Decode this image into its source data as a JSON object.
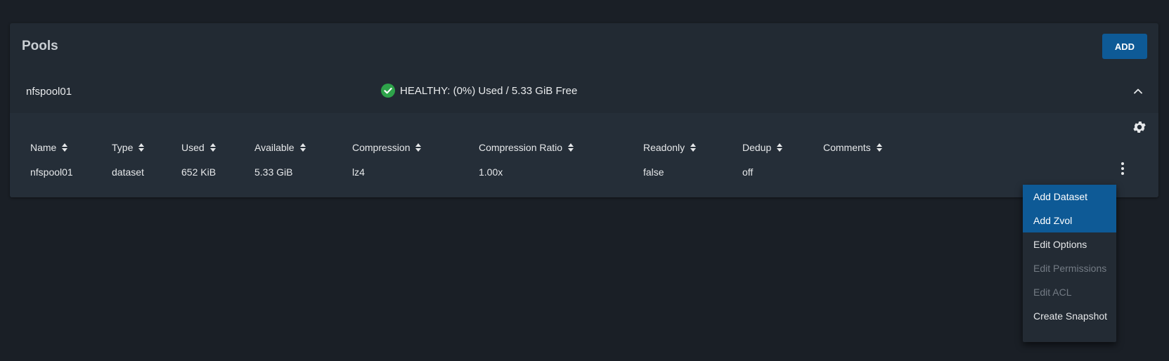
{
  "card": {
    "title": "Pools",
    "add_label": "ADD"
  },
  "pool": {
    "name": "nfspool01",
    "status": "HEALTHY: (0%) Used / 5.33 GiB Free",
    "status_color": "#2ea34a"
  },
  "table": {
    "columns": [
      "Name",
      "Type",
      "Used",
      "Available",
      "Compression",
      "Compression Ratio",
      "Readonly",
      "Dedup",
      "Comments"
    ],
    "rows": [
      [
        "nfspool01",
        "dataset",
        "652 KiB",
        "5.33 GiB",
        "lz4",
        "1.00x",
        "false",
        "off",
        ""
      ]
    ]
  },
  "menu": {
    "items": [
      {
        "label": "Add Dataset",
        "state": "highlighted"
      },
      {
        "label": "Add Zvol",
        "state": "highlighted"
      },
      {
        "label": "Edit Options",
        "state": "enabled"
      },
      {
        "label": "Edit Permissions",
        "state": "disabled"
      },
      {
        "label": "Edit ACL",
        "state": "disabled"
      },
      {
        "label": "Create Snapshot",
        "state": "enabled"
      }
    ]
  },
  "colors": {
    "background": "#1a1f26",
    "card": "#222a33",
    "accent": "#0e5a96"
  }
}
